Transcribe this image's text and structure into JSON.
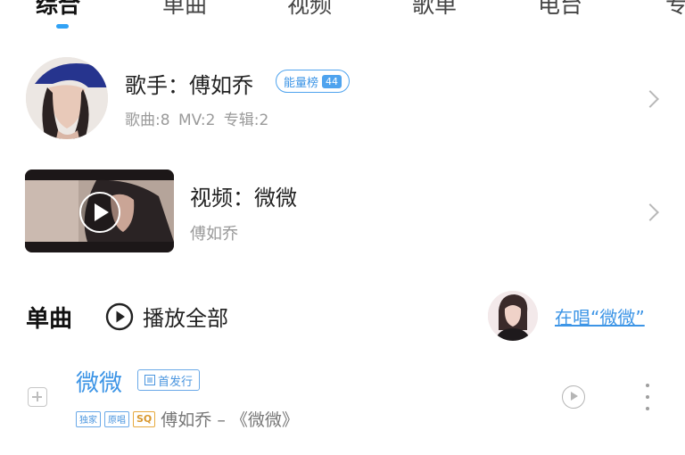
{
  "tabs": [
    {
      "label": "综合",
      "active": true
    },
    {
      "label": "单曲",
      "active": false
    },
    {
      "label": "视频",
      "active": false
    },
    {
      "label": "歌单",
      "active": false
    },
    {
      "label": "电台",
      "active": false
    },
    {
      "label": "专",
      "active": false
    }
  ],
  "singer": {
    "title": "歌手：傅如乔",
    "rank_label": "能量榜",
    "rank_value": "44",
    "stats": "歌曲:8 MV:2 专辑:2"
  },
  "video": {
    "title": "视频：微微",
    "artist": "傅如乔"
  },
  "singles": {
    "section_title": "单曲",
    "play_all_label": "播放全部",
    "singing_link": "在唱“微微”"
  },
  "song": {
    "title": "微微",
    "release_badge": "首发行",
    "tags": [
      "独家",
      "原唱",
      "SQ"
    ],
    "artist_album": "傅如乔 – 《微微》"
  },
  "colors": {
    "accent": "#3d95e6",
    "indicator": "#31a2f5",
    "muted_text": "#9a9a9a",
    "sq_tag": "#d9982f"
  },
  "icons": {
    "chevron": "chevron-right-icon",
    "play_all": "play-circle-icon",
    "add": "plus-square-icon",
    "mv_play": "play-circle-outline-icon",
    "more": "more-vertical-icon"
  }
}
